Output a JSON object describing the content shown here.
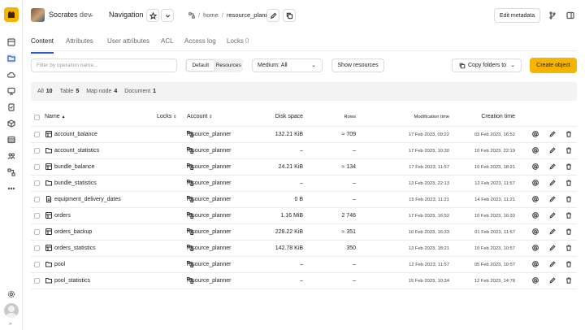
{
  "header": {
    "cluster_name": "Socrates",
    "cluster_env": "dev",
    "navigation_label": "Navigation",
    "breadcrumbs": [
      "home",
      "resource_planner"
    ],
    "edit_metadata_label": "Edit metadata"
  },
  "tabs": [
    {
      "label": "Content"
    },
    {
      "label": "Attributes"
    },
    {
      "label": "User attributes"
    },
    {
      "label": "ACL"
    },
    {
      "label": "Access log"
    },
    {
      "label": "Locks",
      "count": "0"
    }
  ],
  "toolbar": {
    "filter_placeholder": "Filter by operation name...",
    "view_modes": [
      "Default",
      "Resources"
    ],
    "medium_label": "Medium:",
    "medium_value": "All",
    "show_resources_label": "Show resources",
    "copy_folders_label": "Copy folders to",
    "create_label": "Create object"
  },
  "summary": [
    {
      "label": "All",
      "count": "10"
    },
    {
      "label": "Table",
      "count": "5"
    },
    {
      "label": "Map node",
      "count": "4"
    },
    {
      "label": "Document",
      "count": "1"
    }
  ],
  "columns": {
    "name": "Name",
    "locks": "Locks",
    "account": "Account",
    "disk_space": "Disk space",
    "rows": "Rows",
    "modification_time": "Modification time",
    "creation_time": "Creation time"
  },
  "rows": [
    {
      "type": "table",
      "name": "account_balance",
      "account": "resource_planner",
      "disk": "132.21 KiB",
      "rows": "≈ 709",
      "mtime": "17 Feb 2023, 09:22",
      "ctime": "03 Feb 2023, 16:52"
    },
    {
      "type": "folder",
      "name": "account_statistics",
      "account": "resource_planner",
      "disk": "–",
      "rows": "–",
      "mtime": "17 Feb 2023, 10:30",
      "ctime": "10 Feb 2023, 22:19"
    },
    {
      "type": "table",
      "name": "bundle_balance",
      "account": "resource_planner",
      "disk": "24.21 KiB",
      "rows": "≈ 134",
      "mtime": "17 Feb 2023, 11:57",
      "ctime": "10 Feb 2023, 18:21"
    },
    {
      "type": "folder",
      "name": "bundle_statistics",
      "account": "resource_planner",
      "disk": "–",
      "rows": "–",
      "mtime": "13 Feb 2023, 22:13",
      "ctime": "12 Feb 2023, 11:57"
    },
    {
      "type": "document",
      "name": "equipment_delivery_dates",
      "account": "resource_planner",
      "disk": "0 B",
      "rows": "–",
      "mtime": "15 Feb 2023, 11:21",
      "ctime": "14 Feb 2023, 11:21"
    },
    {
      "type": "table",
      "name": "orders",
      "account": "resource_planner",
      "disk": "1.16 MiB",
      "rows": "2 746",
      "mtime": "17 Feb 2023, 16:52",
      "ctime": "10 Feb 2023, 16:33"
    },
    {
      "type": "table",
      "name": "orders_backup",
      "account": "resource_planner",
      "disk": "228.22 KiB",
      "rows": "≈ 351",
      "mtime": "10 Feb 2023, 16:33",
      "ctime": "01 Feb 2023, 11:57"
    },
    {
      "type": "table",
      "name": "orders_statistics",
      "account": "resource_planner",
      "disk": "142.78 KiB",
      "rows": "350",
      "mtime": "13 Feb 2023, 18:21",
      "ctime": "10 Feb 2023, 10:57"
    },
    {
      "type": "folder",
      "name": "pool",
      "account": "resource_planner",
      "disk": "–",
      "rows": "–",
      "mtime": "12 Feb 2023, 11:57",
      "ctime": "05 Feb 2023, 10:57"
    },
    {
      "type": "folder",
      "name": "pool_statistics",
      "account": "resource_planner",
      "disk": "–",
      "rows": "–",
      "mtime": "15 Feb 2023, 10:34",
      "ctime": "12 Feb 2023, 14:78"
    }
  ],
  "colors": {
    "accent": "#2a5ec6",
    "primary_button": "#f6b400"
  }
}
